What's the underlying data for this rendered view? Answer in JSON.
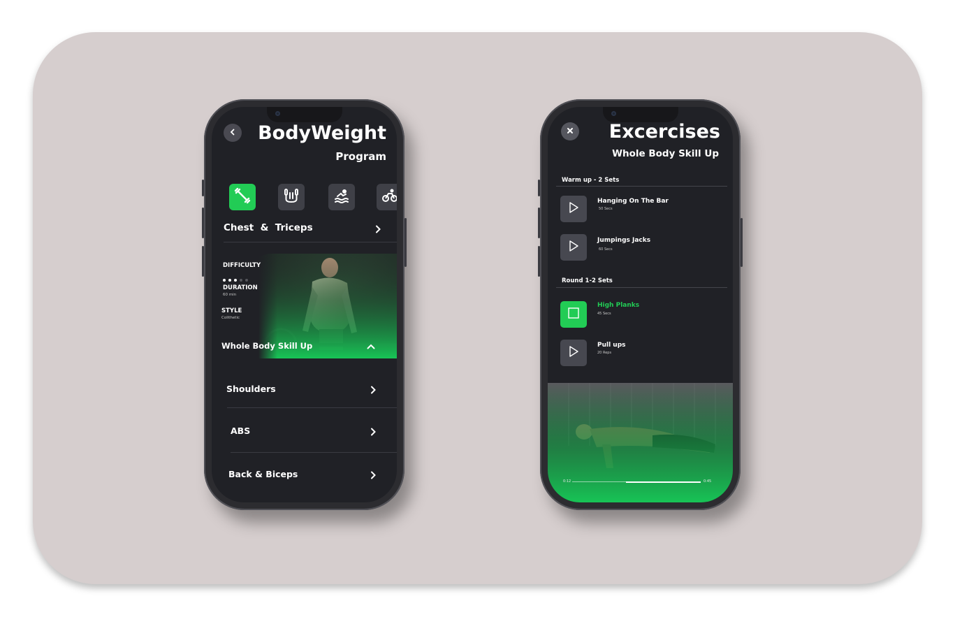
{
  "left_phone": {
    "title": "BodyWeight",
    "subtitle": "Program",
    "categories": [
      {
        "icon": "dumbbell-icon",
        "active": true
      },
      {
        "icon": "jump-rope-icon",
        "active": false
      },
      {
        "icon": "swimming-icon",
        "active": false
      },
      {
        "icon": "cycling-icon",
        "active": false
      }
    ],
    "section_title": "Chest  &  Triceps",
    "program_card": {
      "difficulty_label": "DIFFICULTY",
      "difficulty_level": 3,
      "difficulty_max": 5,
      "duration_label": "DURATION",
      "duration_value": "60 min",
      "style_label": "STYLE",
      "style_value": "Colithetic",
      "name": "Whole Body Skill Up"
    },
    "menu": [
      {
        "label": "Shoulders"
      },
      {
        "label": "ABS"
      },
      {
        "label": "Back & Biceps"
      }
    ]
  },
  "right_phone": {
    "title": "Excercises",
    "subtitle": "Whole Body Skill Up",
    "sections": [
      {
        "title": "Warm up - 2 Sets",
        "items": [
          {
            "name": "Hanging On The Bar",
            "detail": "50 Secs",
            "active": false
          },
          {
            "name": "Jumpings Jacks",
            "detail": "60 Secs",
            "active": false
          }
        ]
      },
      {
        "title": "Round 1-2 Sets",
        "items": [
          {
            "name": "High Planks",
            "detail": "45 Secs",
            "active": true
          },
          {
            "name": "Pull ups",
            "detail": "20 Reps",
            "active": false
          }
        ]
      }
    ],
    "video": {
      "time_current": "0:12",
      "time_total": "0:45"
    }
  },
  "colors": {
    "accent": "#22cc55",
    "screen_bg": "#202126",
    "card_bg": "#d6cece"
  }
}
